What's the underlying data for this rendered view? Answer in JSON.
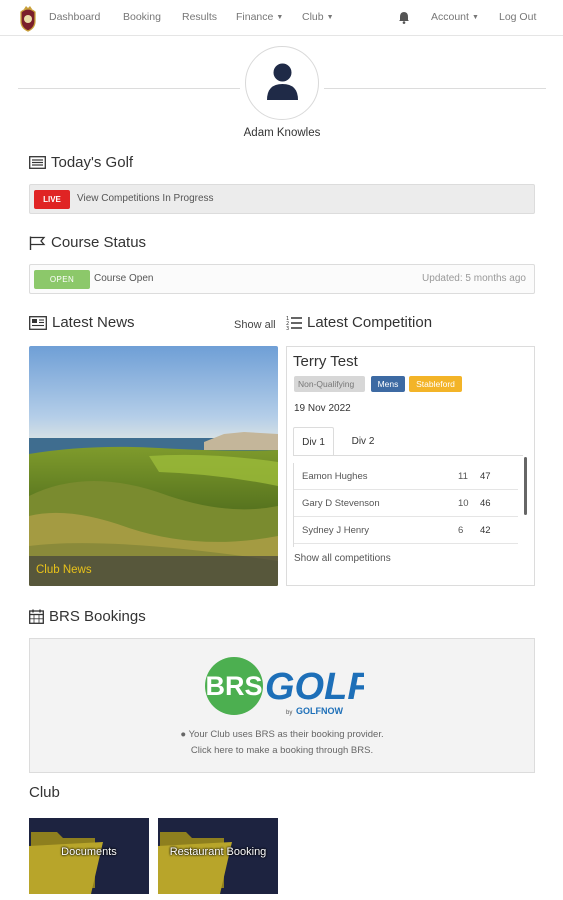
{
  "nav": {
    "items": [
      {
        "label": "Dashboard",
        "dropdown": false
      },
      {
        "label": "Booking",
        "dropdown": false
      },
      {
        "label": "Results",
        "dropdown": false
      },
      {
        "label": "Finance",
        "dropdown": true
      },
      {
        "label": "Club",
        "dropdown": true
      }
    ],
    "account_label": "Account",
    "logout_label": "Log Out",
    "icons": {
      "logo": "club-crest-icon",
      "notifications": "bell-icon"
    }
  },
  "profile": {
    "name": "Adam Knowles",
    "avatar_icon": "user-icon"
  },
  "todays_golf": {
    "title": "Today's Golf",
    "badge": "LIVE",
    "text": "View Competitions In Progress"
  },
  "course_status": {
    "title": "Course Status",
    "badge": "OPEN",
    "text": "Course Open",
    "updated": "Updated: 5 months ago"
  },
  "news": {
    "title": "Latest News",
    "show_all": "Show all",
    "caption": "Club News"
  },
  "competition": {
    "title": "Latest Competition",
    "name": "Terry Test",
    "tags": [
      "Non-Qualifying",
      "Mens",
      "Stableford"
    ],
    "date": "19 Nov 2022",
    "tabs": [
      "Div 1",
      "Div 2"
    ],
    "results": [
      {
        "name": "Eamon Hughes",
        "a": "11",
        "b": "47"
      },
      {
        "name": "Gary D Stevenson",
        "a": "10",
        "b": "46"
      },
      {
        "name": "Sydney J Henry",
        "a": "6",
        "b": "42"
      }
    ],
    "show_all": "Show all competitions"
  },
  "brs": {
    "title": "BRS Bookings",
    "logo_brs": "BRS",
    "logo_golf": "GOLF",
    "logo_by": "by",
    "logo_golfnow": "GOLFNOW",
    "info_line1": "Your Club uses BRS as their booking provider.",
    "info_line2": "Click here to make a booking through BRS."
  },
  "club": {
    "title": "Club",
    "tiles": [
      {
        "label": "Documents"
      },
      {
        "label": "Restaurant Booking"
      }
    ]
  },
  "colors": {
    "live": "#e02424",
    "open": "#8cc86a",
    "mens": "#3d6aa3",
    "stableford": "#f3b428",
    "brs_green": "#4caf50",
    "golf_blue": "#1d6fb8",
    "tile_bg": "#1d2340",
    "folder": "#b8a52a"
  }
}
